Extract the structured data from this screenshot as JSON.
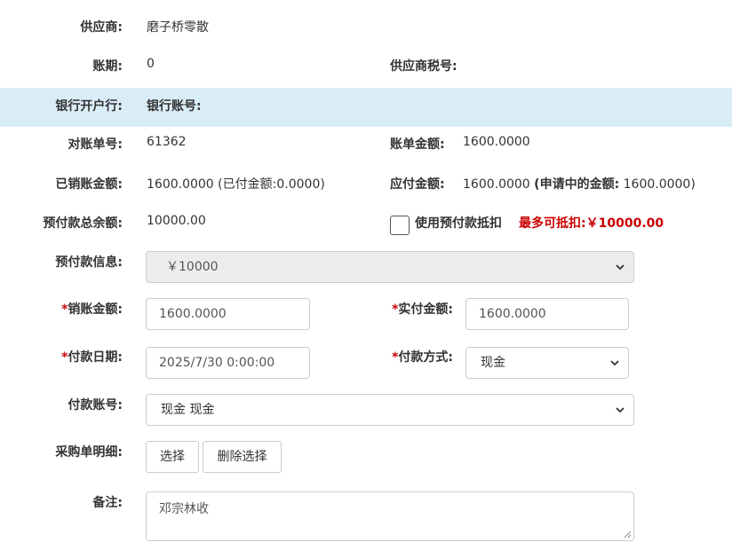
{
  "supplier": {
    "label": "供应商:",
    "value": "磨子桥零散"
  },
  "account_period": {
    "label": "账期:",
    "value": "0"
  },
  "supplier_tax_no": {
    "label": "供应商税号:",
    "value": ""
  },
  "bank": {
    "bank_label": "银行开户行:",
    "bank_value": "",
    "account_label": "银行账号:",
    "account_value": ""
  },
  "statement_no": {
    "label": "对账单号:",
    "value": "61362"
  },
  "bill_amount": {
    "label": "账单金额:",
    "value": "1600.0000"
  },
  "written_off": {
    "label": "已销账金额:",
    "value": "1600.0000",
    "paid_prefix": "(已付金额:",
    "paid_value": "0.0000",
    "paid_suffix": ")"
  },
  "payable": {
    "label": "应付金额:",
    "value": "1600.0000",
    "pending_prefix": "(申请中的金额:",
    "pending_value": "1600.0000",
    "pending_suffix": ")"
  },
  "prepaid_balance": {
    "label": "预付款总余额:",
    "value": "10000.00"
  },
  "use_prepaid": {
    "label": "使用预付款抵扣",
    "max_label": "最多可抵扣:",
    "max_value": "￥10000.00",
    "checked": false
  },
  "prepaid_info": {
    "label": "预付款信息:",
    "selected": "￥10000"
  },
  "writeoff_amount": {
    "required_mark": "*",
    "label": "销账金额:",
    "value": "1600.0000"
  },
  "actual_amount": {
    "required_mark": "*",
    "label": "实付金额:",
    "value": "1600.0000"
  },
  "pay_date": {
    "required_mark": "*",
    "label": "付款日期:",
    "value": "2025/7/30 0:00:00"
  },
  "pay_method": {
    "required_mark": "*",
    "label": "付款方式:",
    "selected": "现金"
  },
  "pay_account": {
    "label": "付款账号:",
    "selected": "现金 现金"
  },
  "po_detail": {
    "label": "采购单明细:",
    "select_button": "选择",
    "delete_button": "删除选择"
  },
  "remark": {
    "label": "备注:",
    "value": "邓宗林收"
  },
  "colors": {
    "highlight_row": "#d9edf7",
    "required": "#cc0000",
    "accent_red": "#cc0000"
  }
}
